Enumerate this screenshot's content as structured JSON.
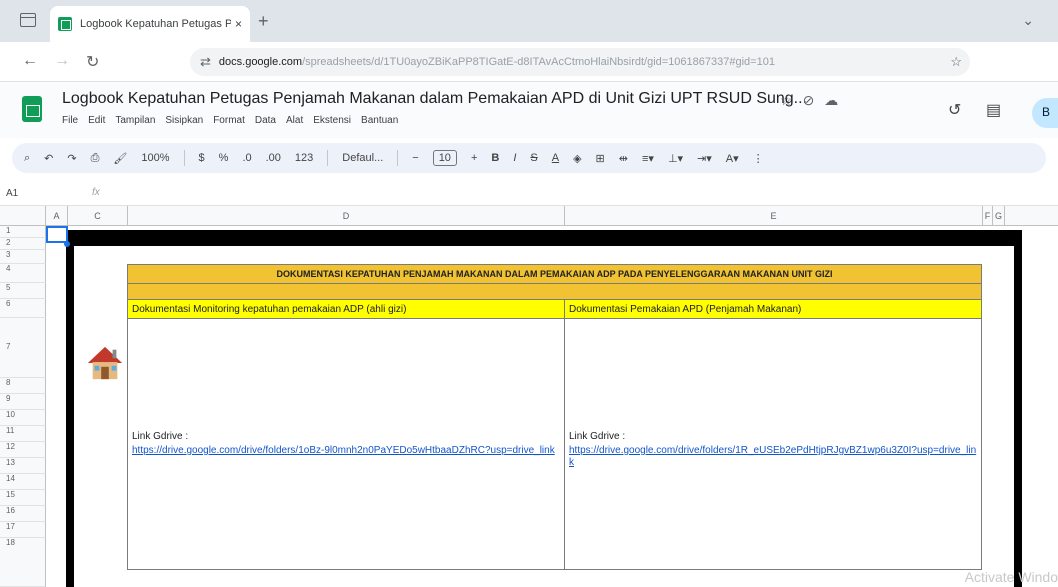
{
  "browser": {
    "tab_title": "Logbook Kepatuhan Petugas P",
    "tab_close": "×",
    "new_tab": "+",
    "url_host": "docs.google.com",
    "url_rest": "/spreadsheets/d/1TU0ayoZBiKaPP8TIGatE-d8ITAvAcCtmoHlaiNbsirdt/gid=1061867337#gid=101",
    "url_prefix": "⇄"
  },
  "sheets": {
    "doc_title": "Logbook Kepatuhan Petugas Penjamah Makanan dalam Pemakaian APD di Unit Gizi UPT RSUD Sung...",
    "menus": [
      "File",
      "Edit",
      "Tampilan",
      "Sisipkan",
      "Format",
      "Data",
      "Alat",
      "Ekstensi",
      "Bantuan"
    ],
    "share_label": "B"
  },
  "toolbar": {
    "zoom": "100%",
    "currency": "$",
    "percent": "%",
    "dec_less": ".0",
    "dec_more": ".00",
    "num_format": "123",
    "font": "Defaul...",
    "font_size": "10",
    "bold": "B",
    "italic": "I",
    "strike": "S",
    "text_color": "A"
  },
  "formula": {
    "cell_ref": "A1",
    "fx": "fx"
  },
  "grid": {
    "columns": [
      "A",
      "C",
      "D",
      "E",
      "F",
      "G"
    ],
    "rows": [
      "1",
      "2",
      "3",
      "4",
      "5",
      "6",
      "7",
      "8",
      "9",
      "10",
      "11",
      "12",
      "13",
      "14",
      "15",
      "16",
      "17",
      "18"
    ]
  },
  "table": {
    "title": "DOKUMENTASI KEPATUHAN PENJAMAH MAKANAN DALAM PEMAKAIAN ADP PADA PENYELENGGARAAN MAKANAN UNIT GIZI",
    "col_d_header": "Dokumentasi Monitoring kepatuhan pemakaian ADP (ahli gizi)",
    "col_e_header": "Dokumentasi Pemakaian APD (Penjamah Makanan)",
    "col_d_link_label": "Link Gdrive :",
    "col_d_link": "https://drive.google.com/drive/folders/1oBz-9l0mnh2n0PaYEDo5wHtbaaDZhRC?usp=drive_link",
    "col_e_link_label": "Link Gdrive :",
    "col_e_link": "https://drive.google.com/drive/folders/1R_eUSEb2ePdHtjpRJgvBZ1wp6u3Z0I?usp=drive_link"
  },
  "watermark": "Activate Windo",
  "colors": {
    "title_fill": "#f1c232",
    "header_fill": "#ffff00",
    "link": "#1155cc"
  }
}
